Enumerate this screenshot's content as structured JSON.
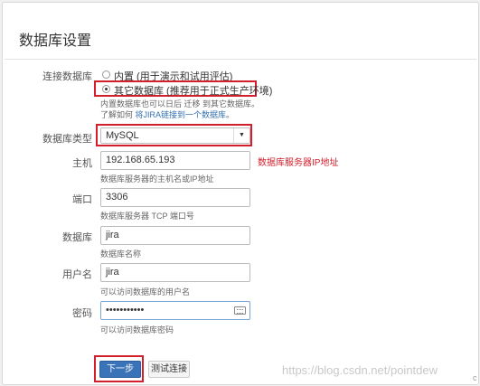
{
  "title": "数据库设置",
  "connection": {
    "label": "连接数据库",
    "options": [
      {
        "label": "内置 (用于演示和试用评估)",
        "selected": false
      },
      {
        "label": "其它数据库 (推荐用于正式生产环境)",
        "selected": true
      }
    ],
    "help1": "内置数据库也可以日后 迁移 到其它数据库。",
    "help2_prefix": "了解如何 ",
    "help2_link": "将JIRA链接到一个数据库",
    "help2_suffix": "。"
  },
  "db_type": {
    "label": "数据库类型",
    "value": "MySQL"
  },
  "host": {
    "label": "主机",
    "value": "192.168.65.193",
    "help": "数据库服务器的主机名或IP地址",
    "annotation": "数据库服务器IP地址"
  },
  "port": {
    "label": "端口",
    "value": "3306",
    "help": "数据库服务器 TCP 端口号"
  },
  "database": {
    "label": "数据库",
    "value": "jira",
    "help": "数据库名称"
  },
  "username": {
    "label": "用户名",
    "value": "jira",
    "help": "可以访问数据库的用户名"
  },
  "password": {
    "label": "密码",
    "value": "•••••••••••",
    "help": "可以访问数据库密码"
  },
  "buttons": {
    "next": "下一步",
    "test": "测试连接"
  },
  "watermark": "https://blog.csdn.net/pointdew",
  "corner_glyph": "c"
}
